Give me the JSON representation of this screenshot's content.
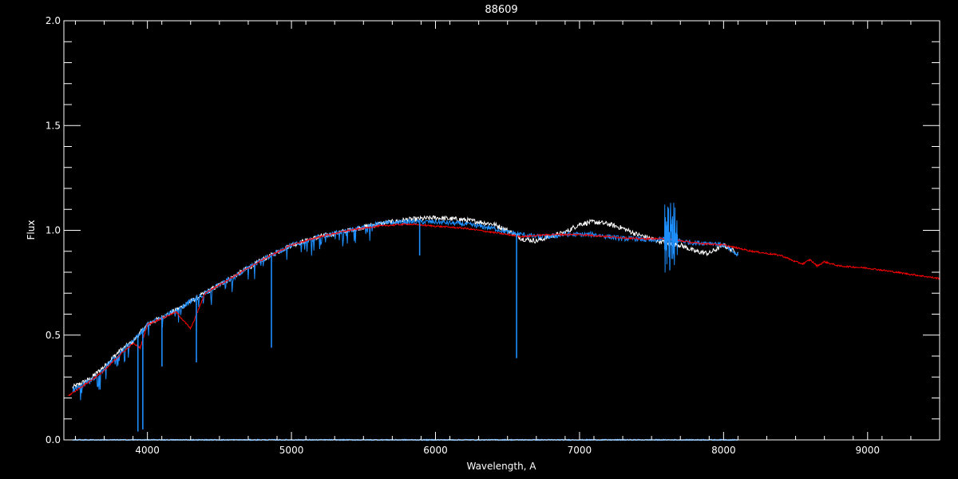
{
  "chart_data": {
    "type": "line",
    "title": "88609",
    "xlabel": "Wavelength, A",
    "ylabel": "Flux",
    "xlim": [
      3420,
      9500
    ],
    "ylim": [
      0.0,
      2.0
    ],
    "grid": false,
    "legend": "none",
    "x_ticks": [
      4000,
      5000,
      6000,
      7000,
      8000,
      9000
    ],
    "x_tick_labels": [
      "4000",
      "5000",
      "6000",
      "7000",
      "8000",
      "9000"
    ],
    "y_ticks": [
      0.0,
      0.5,
      1.0,
      1.5,
      2.0
    ],
    "y_tick_labels": [
      "0.0",
      "0.5",
      "1.0",
      "1.5",
      "2.0"
    ],
    "colors": {
      "background": "#000000",
      "axes": "#ffffff",
      "observed_white": "#ffffff",
      "observed_blue": "#1e8fff",
      "model_red": "#ff0000"
    },
    "series": [
      {
        "color": "#ffffff",
        "x": [
          3480,
          3600,
          3700,
          3800,
          3900,
          4000,
          4200,
          4400,
          4600,
          4800,
          5000,
          5200,
          5400,
          5600,
          5800,
          6000,
          6200,
          6400,
          6500,
          6600,
          6700,
          6800,
          6900,
          7000,
          7100,
          7200,
          7300,
          7400,
          7500,
          7600,
          7700,
          7800,
          7900,
          8000,
          8100
        ],
        "y": [
          0.25,
          0.29,
          0.35,
          0.42,
          0.47,
          0.55,
          0.62,
          0.7,
          0.78,
          0.86,
          0.93,
          0.97,
          1.0,
          1.03,
          1.05,
          1.06,
          1.05,
          1.03,
          1.0,
          0.96,
          0.95,
          0.97,
          0.99,
          1.03,
          1.04,
          1.03,
          1.01,
          0.98,
          0.96,
          0.94,
          0.93,
          0.9,
          0.89,
          0.93,
          0.89
        ]
      },
      {
        "color": "#1e8fff",
        "x": [
          3480,
          3600,
          3700,
          3800,
          3900,
          4000,
          4200,
          4400,
          4600,
          4800,
          5000,
          5200,
          5400,
          5600,
          5800,
          6000,
          6200,
          6400,
          6500,
          6600,
          6700,
          6800,
          6900,
          7000,
          7100,
          7200,
          7300,
          7400,
          7500,
          7600,
          7700,
          7800,
          7900,
          8000,
          8100
        ],
        "y": [
          0.24,
          0.28,
          0.34,
          0.41,
          0.47,
          0.55,
          0.62,
          0.7,
          0.78,
          0.86,
          0.93,
          0.97,
          1.0,
          1.03,
          1.04,
          1.04,
          1.03,
          1.01,
          0.99,
          0.98,
          0.97,
          0.97,
          0.98,
          0.98,
          0.98,
          0.97,
          0.96,
          0.96,
          0.95,
          0.96,
          0.95,
          0.94,
          0.94,
          0.93,
          0.88
        ]
      },
      {
        "color": "#ff0000",
        "x": [
          3450,
          3600,
          3700,
          3800,
          3900,
          3950,
          4000,
          4100,
          4200,
          4300,
          4400,
          4600,
          4800,
          5000,
          5200,
          5400,
          5600,
          5800,
          6000,
          6200,
          6400,
          6600,
          6800,
          7000,
          7200,
          7400,
          7600,
          7800,
          8000,
          8200,
          8400,
          8500,
          8550,
          8600,
          8650,
          8700,
          8800,
          9000,
          9200,
          9400,
          9500
        ],
        "y": [
          0.21,
          0.28,
          0.33,
          0.4,
          0.46,
          0.44,
          0.55,
          0.58,
          0.61,
          0.53,
          0.7,
          0.78,
          0.86,
          0.93,
          0.97,
          1.0,
          1.02,
          1.03,
          1.02,
          1.01,
          0.99,
          0.97,
          0.98,
          0.98,
          0.97,
          0.96,
          0.96,
          0.94,
          0.93,
          0.9,
          0.88,
          0.85,
          0.84,
          0.86,
          0.83,
          0.85,
          0.83,
          0.82,
          0.8,
          0.78,
          0.77
        ]
      },
      {
        "color": "#1e8fff",
        "x": [
          3480,
          8100
        ],
        "y": [
          0.0,
          0.0
        ]
      }
    ],
    "absorption_lines": [
      {
        "x": 3934,
        "y": 0.04
      },
      {
        "x": 3968,
        "y": 0.05
      },
      {
        "x": 4101,
        "y": 0.35
      },
      {
        "x": 4340,
        "y": 0.37
      },
      {
        "x": 4861,
        "y": 0.44
      },
      {
        "x": 5890,
        "y": 0.88
      },
      {
        "x": 6563,
        "y": 0.39
      }
    ],
    "noise_band": {
      "x": [
        7590,
        7680
      ],
      "y": [
        0.78,
        1.14
      ]
    }
  }
}
